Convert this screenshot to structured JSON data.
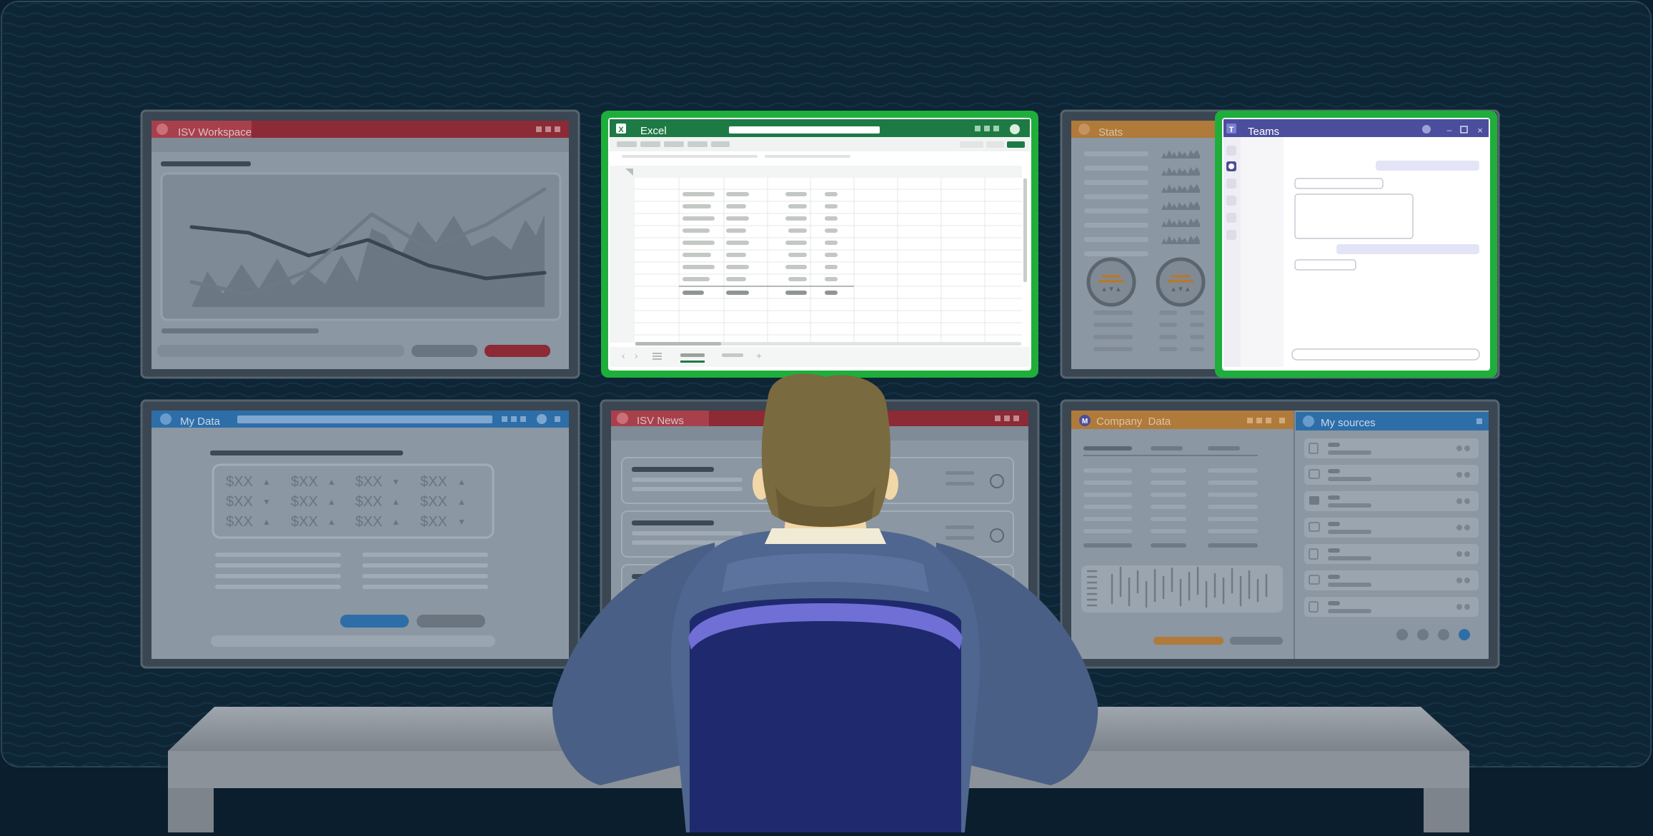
{
  "monitors": {
    "isv_workspace": {
      "title": "ISV Workspace"
    },
    "excel": {
      "title": "Excel",
      "app_letter": "X"
    },
    "stats": {
      "title": "Stats"
    },
    "teams": {
      "title": "Teams",
      "app_letter": "T"
    },
    "my_data": {
      "title": "My Data",
      "price_cell": "$XX"
    },
    "isv_news": {
      "title": "ISV News"
    },
    "company_data": {
      "title": "Company  Data",
      "app_letter": "M"
    },
    "my_sources": {
      "title": "My sources"
    }
  },
  "colors": {
    "background": "#0a1e2d",
    "highlight": "#1fae3b",
    "excel_green": "#1e7a45",
    "teams_purple": "#4b4e9c",
    "isv_red": "#8c2a35",
    "stats_orange": "#b07a3a",
    "my_data_blue": "#2d6ea8"
  }
}
